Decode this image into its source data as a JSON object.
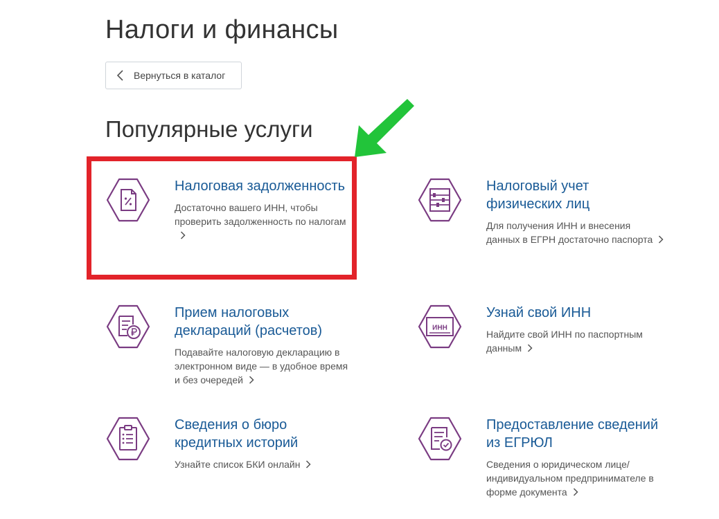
{
  "page": {
    "title": "Налоги и финансы",
    "back_button": "Вернуться в каталог",
    "section_title": "Популярные услуги"
  },
  "colors": {
    "accent_purple": "#7a3b82",
    "link_blue": "#195a96",
    "highlight_red": "#e2232a",
    "arrow_green": "#22c43a"
  },
  "services": [
    {
      "title": "Налоговая задолженность",
      "description": "Достаточно вашего ИНН, чтобы проверить задолженность по налогам",
      "icon": "tax-document-icon"
    },
    {
      "title": "Налоговый учет физических лиц",
      "description": "Для получения ИНН и внесения данных в ЕГРН достаточно паспорта",
      "icon": "abacus-icon"
    },
    {
      "title": "Прием налоговых деклараций (расчетов)",
      "description": "Подавайте налоговую декларацию в электронном виде — в удобное время и без очередей",
      "icon": "ruble-document-icon"
    },
    {
      "title": "Узнай свой ИНН",
      "description": "Найдите свой ИНН по паспортным данным",
      "icon": "inn-card-icon",
      "icon_text": "ИНН"
    },
    {
      "title": "Сведения о бюро кредитных историй",
      "description": "Узнайте список БКИ онлайн",
      "icon": "clipboard-list-icon"
    },
    {
      "title": "Предоставление сведений из ЕГРЮЛ",
      "description": "Сведения о юридическом лице/ индивидуальном предпринимателе в форме документа",
      "icon": "certificate-icon"
    }
  ]
}
